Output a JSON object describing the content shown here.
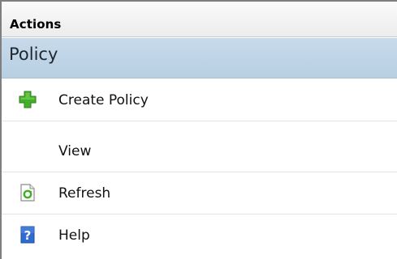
{
  "pane": {
    "title": "Actions"
  },
  "section": {
    "title": "Policy"
  },
  "actions": [
    {
      "label": "Create Policy",
      "icon": "add-plus-icon"
    },
    {
      "label": "View",
      "icon": ""
    },
    {
      "label": "Refresh",
      "icon": "refresh-icon"
    },
    {
      "label": "Help",
      "icon": "help-icon"
    }
  ],
  "colors": {
    "section_bg": "#c6daea",
    "add_icon": "#3fae2a",
    "help_icon": "#2f6bd1"
  }
}
